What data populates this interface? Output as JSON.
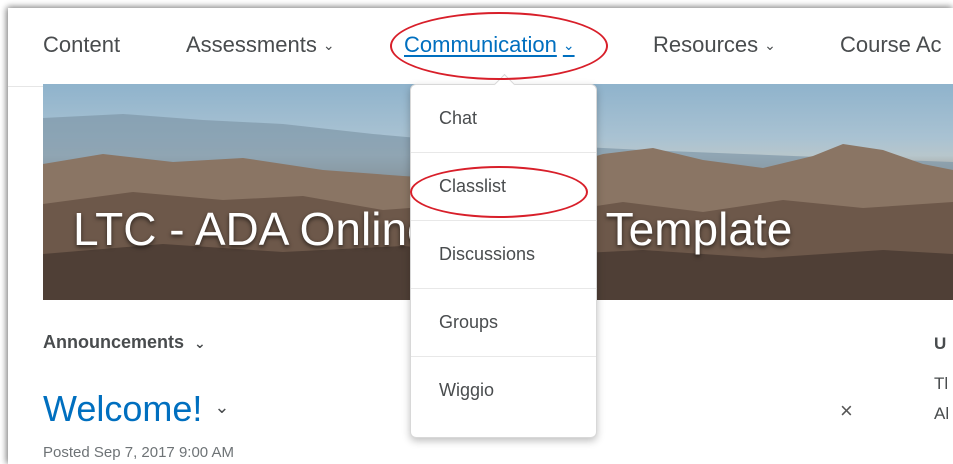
{
  "nav": {
    "items": [
      {
        "label": "Content"
      },
      {
        "label": "Assessments",
        "has_chevron": true
      },
      {
        "label": "Communication",
        "has_chevron": true,
        "active": true
      },
      {
        "label": "Resources",
        "has_chevron": true
      },
      {
        "label": "Course Ac"
      }
    ],
    "chevron_glyph": "⌄"
  },
  "banner": {
    "title": "LTC - ADA Online Course Template"
  },
  "dropdown": {
    "items": [
      {
        "label": "Chat"
      },
      {
        "label": "Classlist",
        "highlighted": true
      },
      {
        "label": "Discussions"
      },
      {
        "label": "Groups"
      },
      {
        "label": "Wiggio"
      }
    ]
  },
  "announcements": {
    "heading": "Announcements",
    "post_title": "Welcome!",
    "posted": "Posted Sep 7, 2017 9:00 AM",
    "close_glyph": "×"
  },
  "right_column": {
    "heading": "U",
    "line1": "Tl",
    "line2": "Al"
  },
  "colors": {
    "link_blue": "#006fbf",
    "highlight_red": "#d81f2a",
    "text_gray": "#494c4e"
  }
}
